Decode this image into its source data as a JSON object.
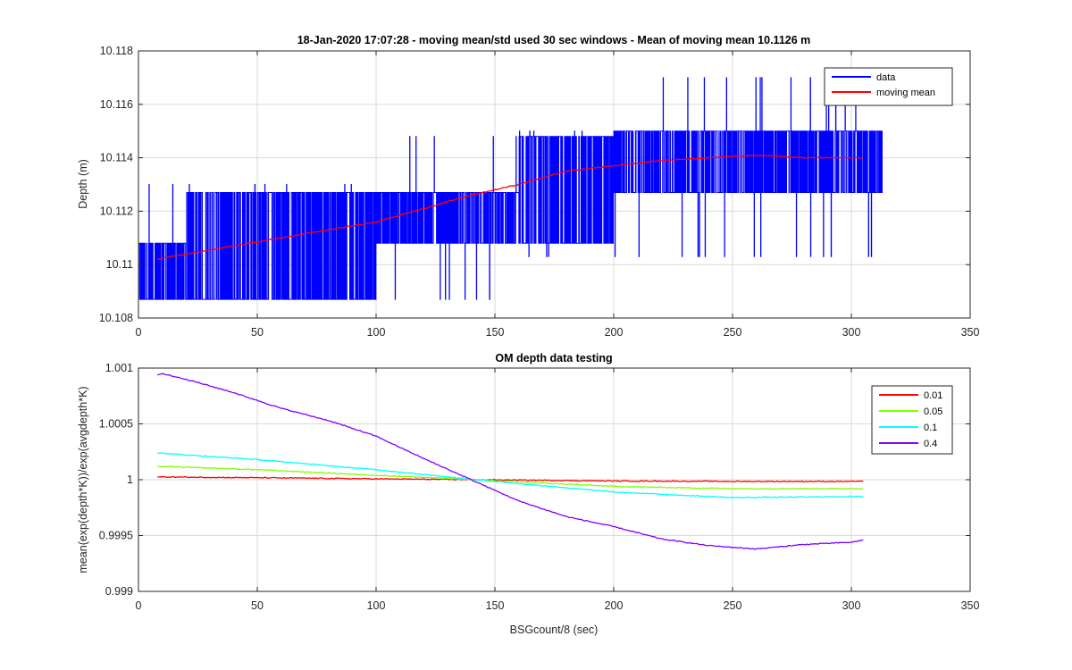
{
  "chart_data": [
    {
      "type": "line",
      "title": "18-Jan-2020 17:07:28 - moving mean/std used 30 sec windows - Mean of moving mean 10.1126 m",
      "xlabel": "",
      "ylabel": "Depth (m)",
      "xlim": [
        0,
        350
      ],
      "ylim": [
        10.108,
        10.118
      ],
      "xticks": [
        "0",
        "50",
        "100",
        "150",
        "200",
        "250",
        "300",
        "350"
      ],
      "yticks": [
        "10.108",
        "10.11",
        "10.112",
        "10.114",
        "10.116",
        "10.118"
      ],
      "grid": true,
      "legend_position": "top-right",
      "series": [
        {
          "name": "data",
          "color": "#0000ff",
          "x_range": [
            0,
            313
          ],
          "levels": [
            10.1087,
            10.1089,
            10.1093,
            10.1098,
            10.1103,
            10.1108,
            10.1127,
            10.113,
            10.1134,
            10.1141,
            10.1148,
            10.115,
            10.117
          ],
          "segments": [
            {
              "x": [
                0,
                20
              ],
              "lo": 10.1087,
              "hi": 10.111,
              "spike_lo": 10.1085,
              "spike_hi": 10.113
            },
            {
              "x": [
                20,
                100
              ],
              "lo": 10.1087,
              "hi": 10.1127,
              "spike_lo": 10.1085,
              "spike_hi": 10.113
            },
            {
              "x": [
                100,
                160
              ],
              "lo": 10.1108,
              "hi": 10.1127,
              "spike_lo": 10.1088,
              "spike_hi": 10.1148
            },
            {
              "x": [
                160,
                200
              ],
              "lo": 10.1108,
              "hi": 10.1148,
              "spike_lo": 10.1103,
              "spike_hi": 10.115
            },
            {
              "x": [
                200,
                313
              ],
              "lo": 10.1127,
              "hi": 10.115,
              "spike_lo": 10.1103,
              "spike_hi": 10.117
            }
          ]
        },
        {
          "name": "moving mean",
          "color": "#ff0000",
          "x": [
            8,
            20,
            40,
            60,
            80,
            100,
            120,
            140,
            160,
            180,
            200,
            220,
            240,
            260,
            280,
            305
          ],
          "y": [
            10.1102,
            10.1104,
            10.1107,
            10.111,
            10.1113,
            10.1116,
            10.1121,
            10.1126,
            10.113,
            10.1135,
            10.1137,
            10.1139,
            10.114,
            10.1141,
            10.114,
            10.114
          ]
        }
      ]
    },
    {
      "type": "line",
      "title": "OM depth data testing",
      "xlabel": "BSGcount/8 (sec)",
      "ylabel": "mean(exp(depth*K))/exp(avgdepth*K)",
      "xlim": [
        0,
        350
      ],
      "ylim": [
        0.999,
        1.001
      ],
      "xticks": [
        "0",
        "50",
        "100",
        "150",
        "200",
        "250",
        "300",
        "350"
      ],
      "yticks": [
        "0.999",
        "0.9995",
        "1",
        "1.0005",
        "1.001"
      ],
      "grid": true,
      "legend_position": "top-right",
      "series": [
        {
          "name": "0.01",
          "color": "#ff0000",
          "x": [
            8,
            50,
            100,
            142,
            200,
            250,
            305
          ],
          "y": [
            1.000025,
            1.000018,
            1.000008,
            1.0,
            0.999989,
            0.999985,
            0.999985
          ]
        },
        {
          "name": "0.05",
          "color": "#80ff00",
          "x": [
            8,
            50,
            100,
            142,
            200,
            250,
            305
          ],
          "y": [
            1.00012,
            1.00009,
            1.00004,
            1.0,
            0.99994,
            0.99992,
            0.99992
          ]
        },
        {
          "name": "0.1",
          "color": "#00ffff",
          "x": [
            8,
            50,
            100,
            142,
            200,
            250,
            305
          ],
          "y": [
            1.00024,
            1.00018,
            1.00009,
            1.0,
            0.99989,
            0.99984,
            0.99985
          ]
        },
        {
          "name": "0.4",
          "color": "#8000ff",
          "x": [
            8,
            10,
            20,
            40,
            60,
            80,
            100,
            120,
            140,
            160,
            180,
            200,
            220,
            240,
            260,
            280,
            300,
            305
          ],
          "y": [
            1.00094,
            1.00095,
            1.0009,
            1.00078,
            1.00064,
            1.00053,
            1.00039,
            1.00019,
            1.0,
            0.99981,
            0.99967,
            0.99958,
            0.99947,
            0.99941,
            0.99938,
            0.99942,
            0.99944,
            0.99946
          ]
        }
      ]
    }
  ]
}
